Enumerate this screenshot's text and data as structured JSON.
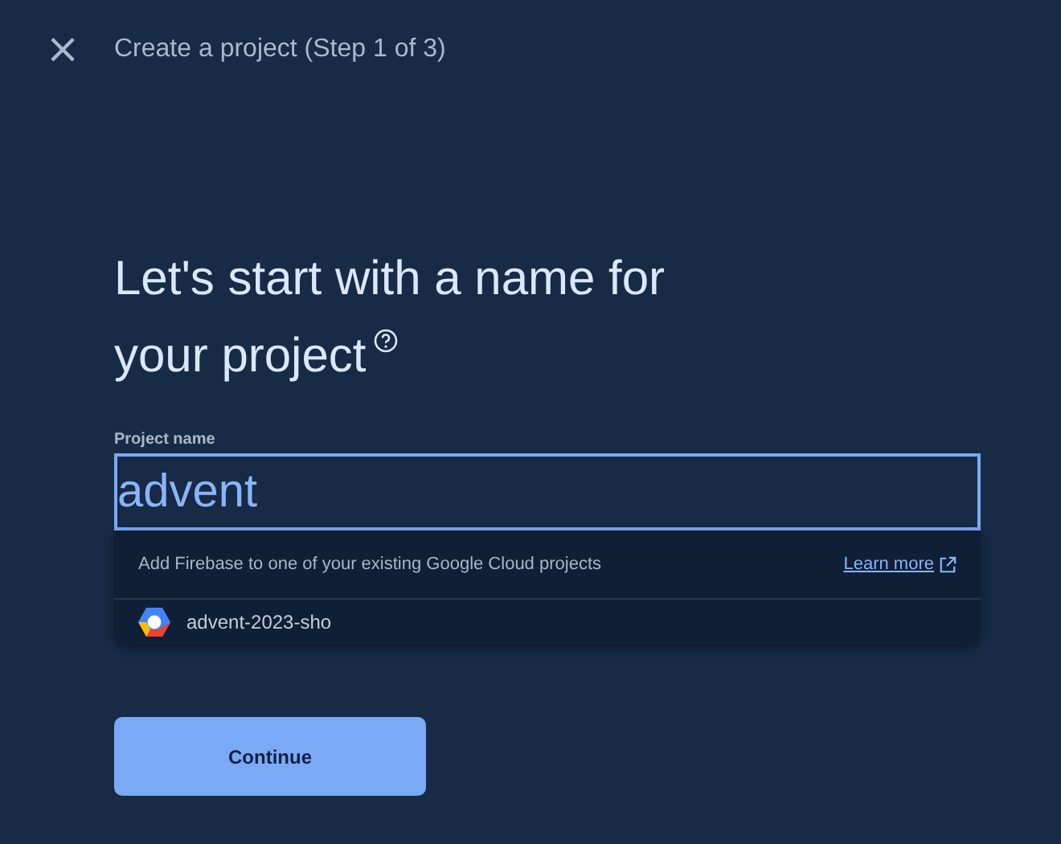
{
  "header": {
    "close": "×",
    "title": "Create a project (Step 1 of 3)"
  },
  "heading_lines": [
    "Let's start with a name for",
    "your project"
  ],
  "field": {
    "label": "Project name",
    "value": "advent"
  },
  "suggestions": {
    "hint": "Add Firebase to one of your existing Google Cloud projects",
    "link": "Learn more",
    "items": [
      {
        "name": "advent-2023-sho"
      }
    ]
  },
  "button": "Continue"
}
